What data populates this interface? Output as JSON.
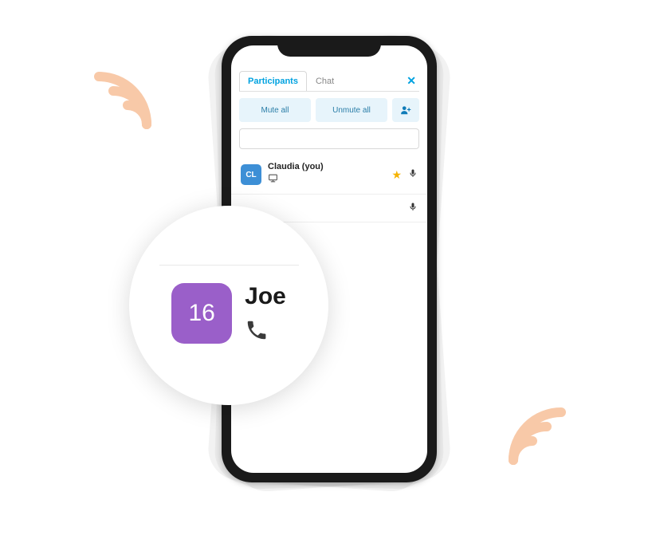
{
  "tabs": {
    "participants": "Participants",
    "chat": "Chat"
  },
  "actions": {
    "mute_all": "Mute all",
    "unmute_all": "Unmute all"
  },
  "search": {
    "value": ""
  },
  "participants": [
    {
      "initials": "CL",
      "name": "Claudia (you)",
      "device": "desktop",
      "host": true,
      "mic": true,
      "avatar_color": "#3d8fd6"
    }
  ],
  "zoomed": {
    "avatar_text": "16",
    "name": "Joe",
    "device": "phone",
    "avatar_color": "#9a5fc9"
  },
  "colors": {
    "accent": "#00a2e0",
    "action_bg": "#e7f4fb",
    "star": "#f5b301",
    "arc": "#f8c9a8"
  }
}
